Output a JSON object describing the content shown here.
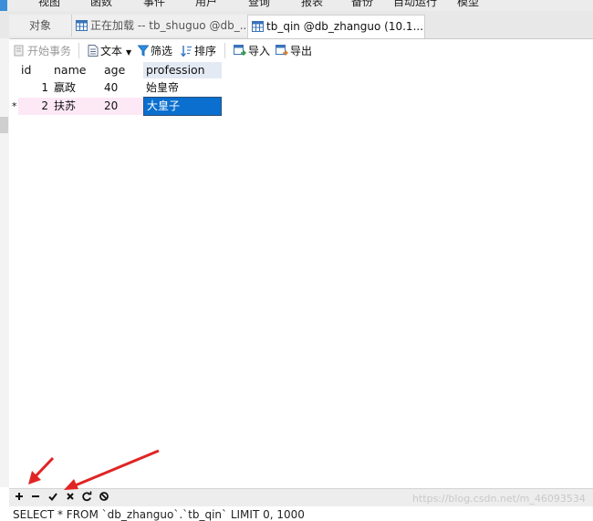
{
  "menu": {
    "items": [
      "视图",
      "函数",
      "事件",
      "用户",
      "查询",
      "报表",
      "备份",
      "自动运行",
      "模型"
    ]
  },
  "tabs": [
    {
      "label": "对象"
    },
    {
      "label": "正在加载 -- tb_shuguo @db_..."
    },
    {
      "label": "tb_qin @db_zhanguo (10.1...."
    }
  ],
  "toolbar": {
    "begin_transaction": "开始事务",
    "text": "文本",
    "filter": "筛选",
    "sort": "排序",
    "import": "导入",
    "export": "导出"
  },
  "grid": {
    "columns": [
      "id",
      "name",
      "age",
      "profession"
    ],
    "rows": [
      {
        "marker": "",
        "id": "1",
        "name": "嬴政",
        "age": "40",
        "profession": "始皇帝"
      },
      {
        "marker": "*",
        "id": "2",
        "name": "扶苏",
        "age": "20",
        "profession": "大皇子"
      }
    ]
  },
  "bottom_toolbar": {
    "watermark": "https://blog.csdn.net/m_46093534"
  },
  "status": {
    "sql": "SELECT * FROM `db_zhanguo`.`tb_qin` LIMIT 0, 1000"
  },
  "colors": {
    "selected_cell": "#0a6fcf",
    "row_highlight": "#fde8f6",
    "annotation_arrow": "#e02424"
  }
}
